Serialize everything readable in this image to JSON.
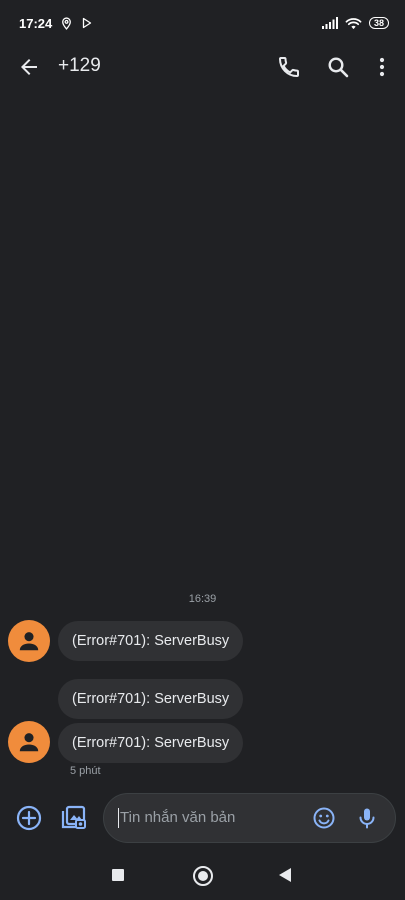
{
  "status_bar": {
    "time": "17:24",
    "battery": "38",
    "icons": [
      "location-pin-icon",
      "play-store-icon",
      "signal-icon",
      "wifi-icon",
      "battery-icon"
    ]
  },
  "app_bar": {
    "title": "+129",
    "icons": [
      "back-arrow-icon",
      "phone-icon",
      "search-icon",
      "more-vert-icon"
    ]
  },
  "conversation": {
    "timestamp": "16:39",
    "messages": [
      {
        "text": "(Error#701): ServerBusy"
      },
      {
        "text": "(Error#701): ServerBusy"
      },
      {
        "text": "(Error#701): ServerBusy"
      }
    ],
    "last_meta": "5 phút"
  },
  "compose": {
    "placeholder": "Tin nhắn văn bản",
    "icons": [
      "add-circle-icon",
      "media-gallery-icon",
      "emoji-icon",
      "microphone-icon"
    ]
  },
  "colors": {
    "background": "#202124",
    "bubble": "#303134",
    "avatar": "#f08c3c",
    "accent": "#8ab4f8"
  }
}
